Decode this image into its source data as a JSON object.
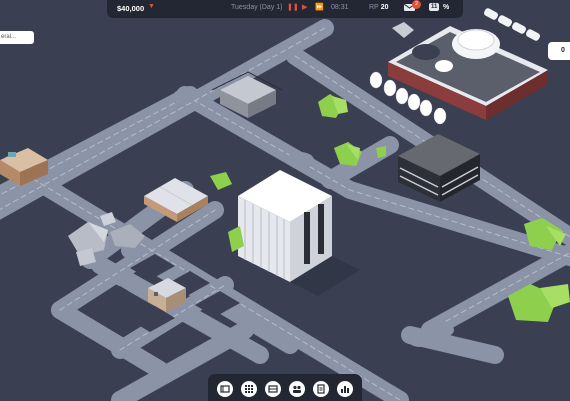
{
  "hud": {
    "money": "$40,000",
    "day": "Tuesday (Day 1)",
    "time": "08:31",
    "rp_label": "RP",
    "rp_value": "20",
    "notification_count": "2",
    "tax_rate": "11",
    "tax_suffix": "%"
  },
  "left_panel": {
    "text": "eral..."
  },
  "right_panel": {
    "text": "0"
  },
  "toolbar": {
    "buttons": [
      {
        "name": "build-icon"
      },
      {
        "name": "zones-icon"
      },
      {
        "name": "plans-icon"
      },
      {
        "name": "staff-icon"
      },
      {
        "name": "contracts-icon"
      },
      {
        "name": "stats-icon"
      }
    ]
  },
  "colors": {
    "ground": "#3a4052",
    "road": "#8b93a6",
    "road_marking": "#b7bdcc",
    "hud": "#232733",
    "accent": "#e0503c",
    "tree": "#8ed04e"
  }
}
